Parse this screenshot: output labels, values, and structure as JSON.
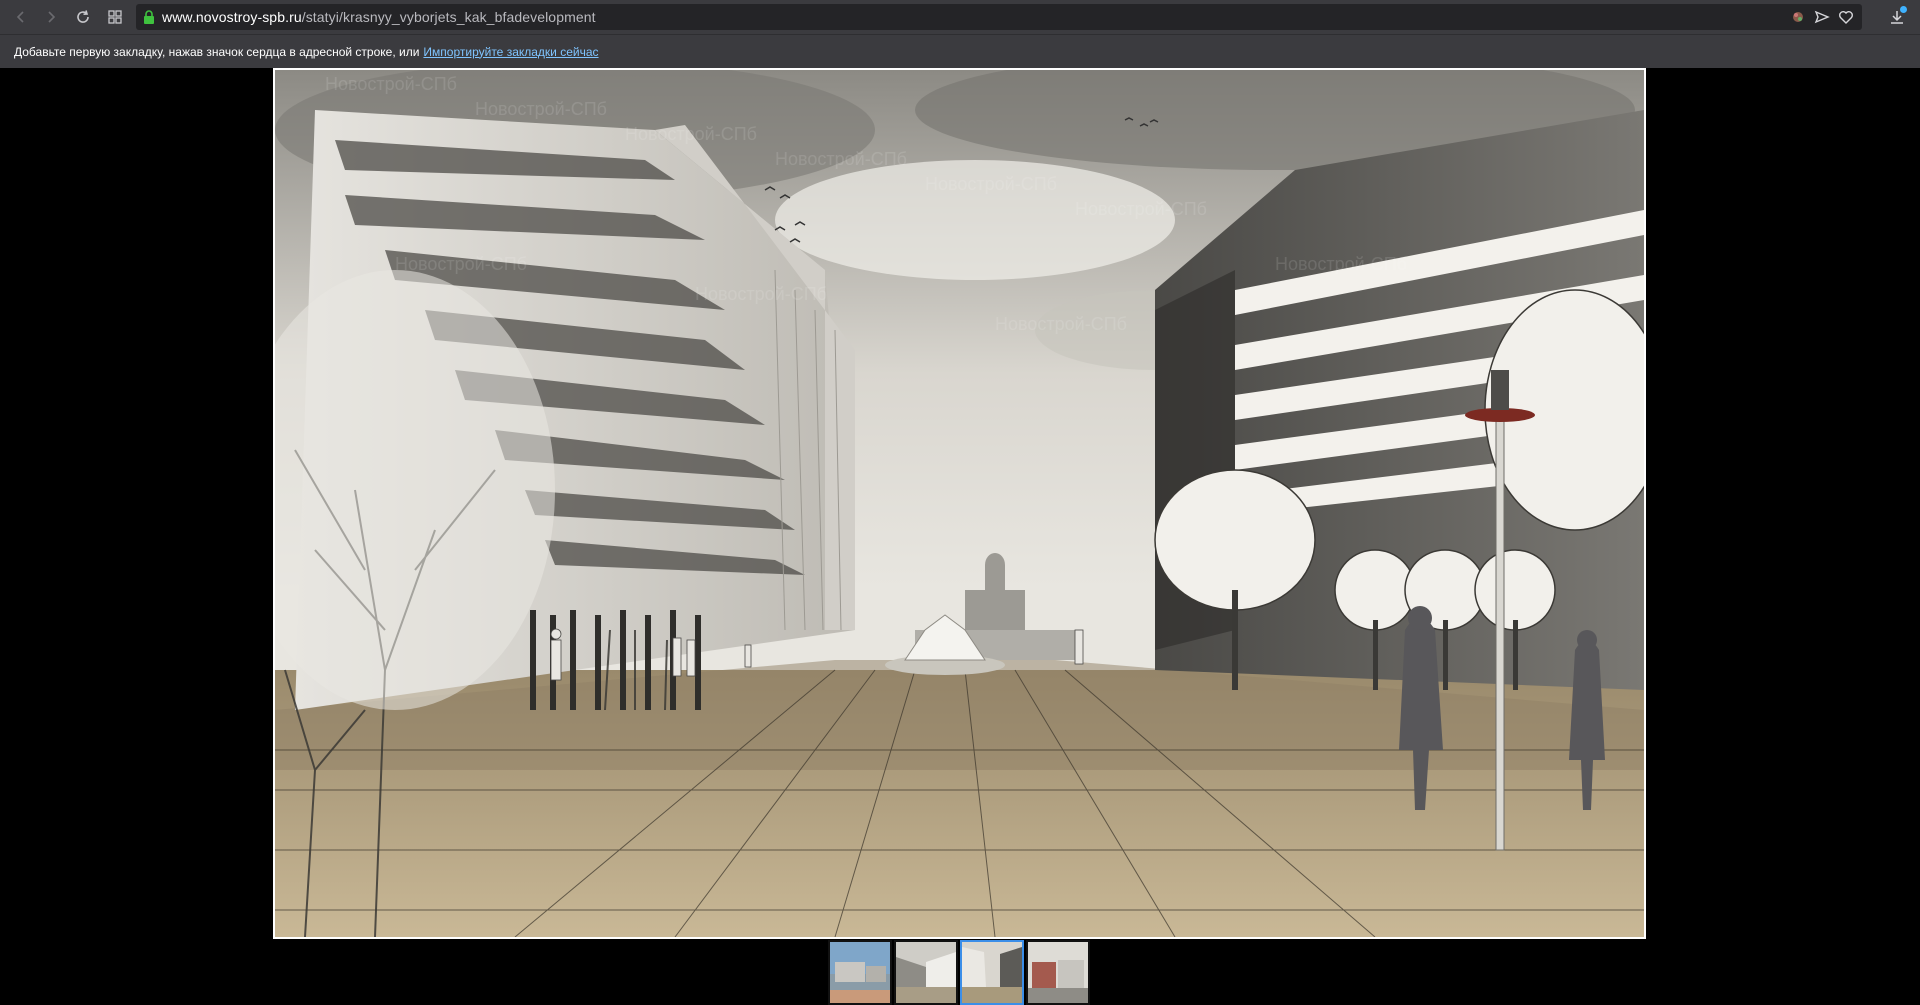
{
  "browser": {
    "url_host": "www.novostroy-spb.ru",
    "url_path": "/statyi/krasnyy_vyborjets_kak_bfadevelopment",
    "nav_icons": [
      "back-icon",
      "forward-icon",
      "reload-icon",
      "tabs-grid-icon"
    ],
    "address_icons": [
      "lock-icon",
      "extension-icon",
      "send-icon",
      "heart-icon",
      "download-icon"
    ]
  },
  "bookmarks_bar": {
    "text": "Добавьте первую закладку, нажав значок сердца в адресной строке, или",
    "link": "Импортируйте закладки сейчас"
  },
  "gallery": {
    "main_image": "architectural-rendering-street-view",
    "watermark": "Новострой-СПб",
    "thumbnails": [
      {
        "name": "thumbnail-1",
        "active": false
      },
      {
        "name": "thumbnail-2",
        "active": false
      },
      {
        "name": "thumbnail-3",
        "active": true
      },
      {
        "name": "thumbnail-4",
        "active": false
      }
    ]
  },
  "colors": {
    "accent": "#3b8ee8",
    "chrome": "#3b3b3f",
    "link": "#7fc4ff"
  }
}
